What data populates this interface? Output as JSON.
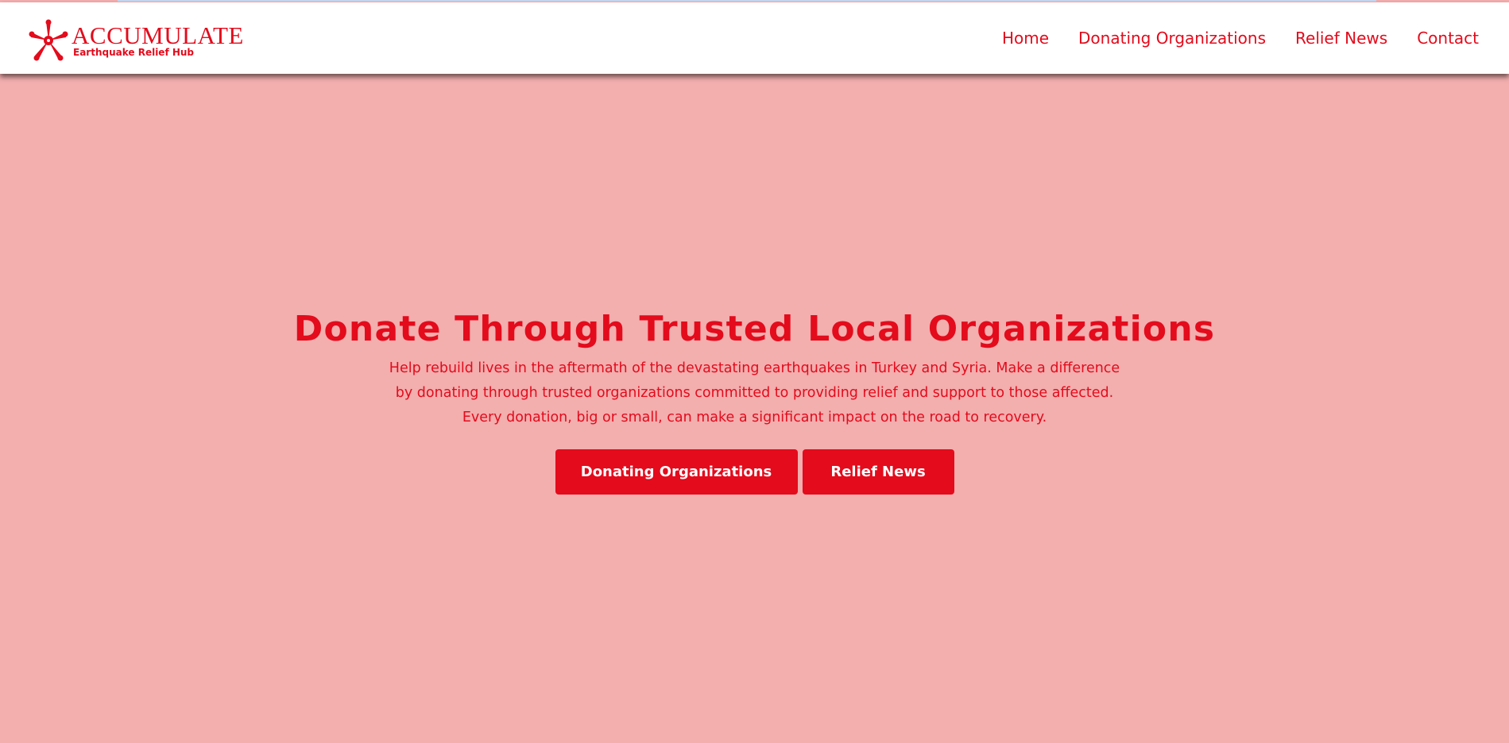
{
  "colors": {
    "brand_red": "#e30b1c",
    "page_background": "#f3aeae",
    "navbar_background": "#ffffff"
  },
  "logo": {
    "title": "ACCUMULATE",
    "subtitle": "Earthquake Relief Hub",
    "icon": "people-hands-star-icon"
  },
  "nav": {
    "items": [
      {
        "label": "Home"
      },
      {
        "label": "Donating Organizations"
      },
      {
        "label": "Relief News"
      },
      {
        "label": "Contact"
      }
    ]
  },
  "hero": {
    "title": "Donate Through Trusted Local Organizations",
    "description_lines": [
      "Help rebuild lives in the aftermath of the devastating earthquakes in Turkey and Syria. Make a difference",
      "by donating through trusted organizations committed to providing relief and support to those affected.",
      "Every donation, big or small, can make a significant impact on the road to recovery."
    ],
    "buttons": {
      "orgs_label": "Donating Organizations",
      "news_label": "Relief News"
    }
  }
}
